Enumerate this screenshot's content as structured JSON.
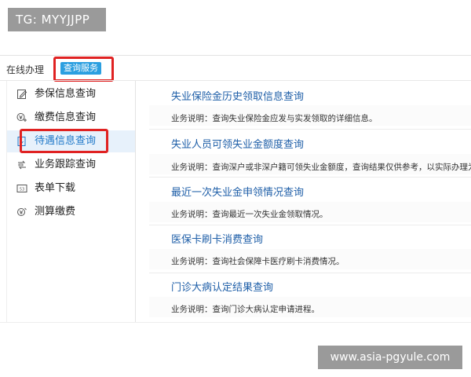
{
  "badge": {
    "text": "TG: MYYJJPP"
  },
  "header": {
    "online_label": "在线办理",
    "query_tab": "查询服务"
  },
  "sidebar": {
    "items": [
      {
        "label": "参保信息查询",
        "icon": "edit-icon"
      },
      {
        "label": "缴费信息查询",
        "icon": "payment-icon"
      },
      {
        "label": "待遇信息查询",
        "icon": "benefit-icon",
        "active": true
      },
      {
        "label": "业务跟踪查询",
        "icon": "track-icon"
      },
      {
        "label": "表单下载",
        "icon": "form-icon"
      },
      {
        "label": "测算缴费",
        "icon": "calc-icon"
      }
    ]
  },
  "services": [
    {
      "title": "失业保险金历史领取信息查询",
      "desc": "业务说明：查询失业保险金应发与实发领取的详细信息。"
    },
    {
      "title": "失业人员可领失业金额度查询",
      "desc": "业务说明：查询深户或非深户籍可领失业金额度，查询结果仅供参考，以实际办理为准"
    },
    {
      "title": "最近一次失业金申领情况查询",
      "desc": "业务说明：查询最近一次失业金领取情况。"
    },
    {
      "title": "医保卡刷卡消费查询",
      "desc": "业务说明：查询社会保障卡医疗刷卡消费情况。"
    },
    {
      "title": "门诊大病认定结果查询",
      "desc": "业务说明：查询门诊大病认定申请进程。"
    }
  ],
  "watermark": {
    "text": "www.asia-pgyule.com"
  },
  "colors": {
    "highlight": "#e02222",
    "accent": "#2b9fe0",
    "link": "#1f5fa8"
  }
}
